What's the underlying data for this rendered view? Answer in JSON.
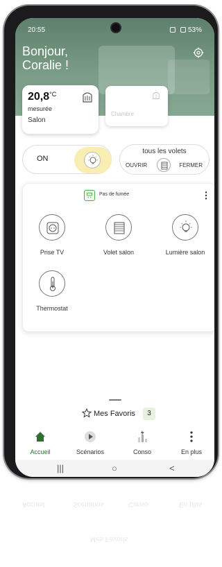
{
  "status_bar": {
    "time": "20:55",
    "battery": "53%"
  },
  "header": {
    "greeting": "Bonjour,\nCoralie !"
  },
  "thermo_card": {
    "temperature": "20,8",
    "unit": "°C",
    "label": "mesurée",
    "room": "Salon"
  },
  "room_card": {
    "room": "Chambre"
  },
  "lights_toggle": {
    "state": "ON"
  },
  "shutters": {
    "title": "tous les volets",
    "open_label": "OUVRIR",
    "close_label": "FERMER"
  },
  "devices_card": {
    "smoke_status": "Pas de fumée",
    "items": [
      {
        "label": "Prise TV",
        "icon": "socket-icon"
      },
      {
        "label": "Volet salon",
        "icon": "shutter-icon"
      },
      {
        "label": "Lumière salon",
        "icon": "bulb-icon"
      },
      {
        "label": "Thermostat",
        "icon": "thermometer-icon"
      }
    ]
  },
  "favorites": {
    "label": "Mes Favoris",
    "count": "3"
  },
  "nav": {
    "items": [
      {
        "label": "Accueil",
        "icon": "home-icon"
      },
      {
        "label": "Scénarios",
        "icon": "play-icon"
      },
      {
        "label": "Conso",
        "icon": "chart-icon"
      },
      {
        "label": "En plus",
        "icon": "more-icon"
      }
    ]
  },
  "system_nav": {
    "recents": "|||",
    "home": "○",
    "back": "<"
  },
  "colors": {
    "accent": "#2e6e2e",
    "hero": "#6f907b",
    "toggle_glow": "#f8eeb2"
  }
}
